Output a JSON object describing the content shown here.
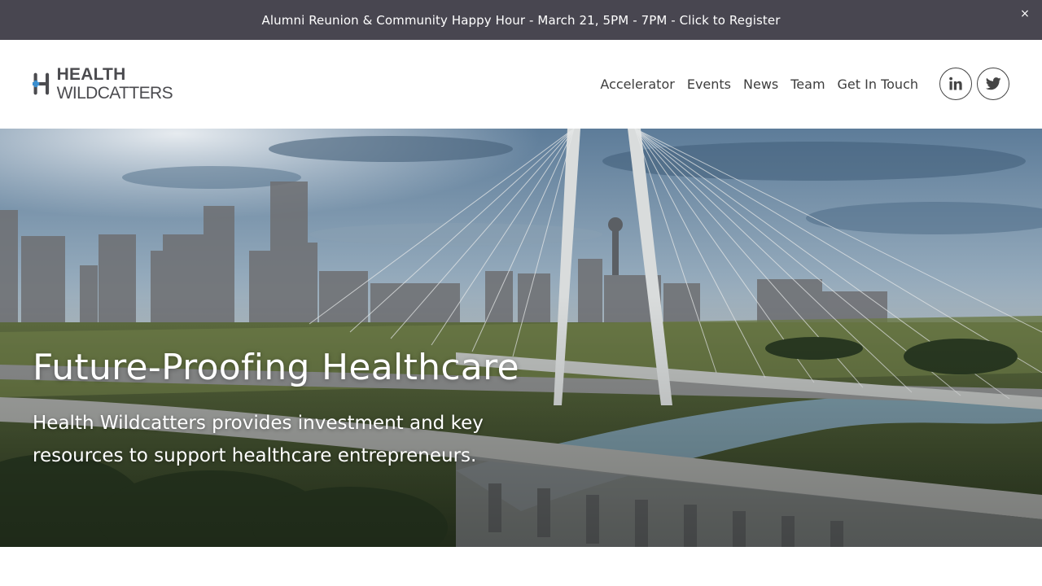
{
  "announcement": {
    "text": "Alumni Reunion & Community Happy Hour - March 21, 5PM - 7PM - Click to Register",
    "close_label": "×"
  },
  "header": {
    "logo": {
      "line1": "HEALTH",
      "line2": "WILDCATTERS"
    },
    "nav": [
      {
        "label": "Accelerator"
      },
      {
        "label": "Events"
      },
      {
        "label": "News"
      },
      {
        "label": "Team"
      },
      {
        "label": "Get In Touch"
      }
    ],
    "social": [
      {
        "icon": "linkedin-icon"
      },
      {
        "icon": "twitter-icon"
      }
    ]
  },
  "hero": {
    "title": "Future-Proofing Healthcare",
    "subtitle": "Health Wildcatters provides investment and key resources to support healthcare entrepreneurs."
  },
  "colors": {
    "announcement_bg": "#484650",
    "logo_gray": "#4b4b4f",
    "logo_blue": "#3a8fd0",
    "nav_text": "#3d3d3d"
  }
}
